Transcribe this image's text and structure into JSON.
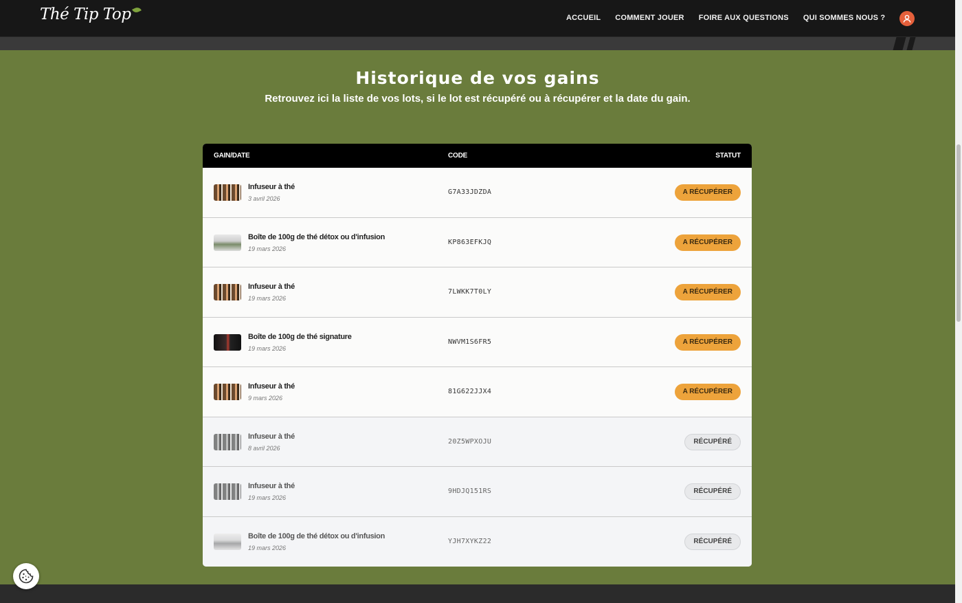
{
  "header": {
    "logo_text": "Thé Tip Top",
    "nav": [
      "ACCUEIL",
      "COMMENT JOUER",
      "FOIRE AUX QUESTIONS",
      "QUI SOMMES NOUS ?"
    ],
    "user_icon": "user-icon",
    "accent_color": "#e5603b"
  },
  "page": {
    "title": "Historique de vos gains",
    "subtitle": "Retrouvez ici la liste de vos lots, si le lot est récupéré ou à récupérer et la date du gain.",
    "background_color": "#6a7c3c"
  },
  "table": {
    "columns": [
      "GAIN/DATE",
      "CODE",
      "STATUT"
    ],
    "rows": [
      {
        "prize": "Infuseur à thé",
        "date": "3 avril 2026",
        "code": "G7A33JDZDA",
        "status": "A RÉCUPÉRER",
        "state": "pending",
        "image": "infuser"
      },
      {
        "prize": "Boîte de 100g de thé détox ou d'infusion",
        "date": "19 mars 2026",
        "code": "KP863EFKJQ",
        "status": "A RÉCUPÉRER",
        "state": "pending",
        "image": "box"
      },
      {
        "prize": "Infuseur à thé",
        "date": "19 mars 2026",
        "code": "7LWKK7T0LY",
        "status": "A RÉCUPÉRER",
        "state": "pending",
        "image": "infuser"
      },
      {
        "prize": "Boîte de 100g de thé signature",
        "date": "19 mars 2026",
        "code": "NWVM1S6FR5",
        "status": "A RÉCUPÉRER",
        "state": "pending",
        "image": "signature"
      },
      {
        "prize": "Infuseur à thé",
        "date": "9 mars 2026",
        "code": "81G622JJX4",
        "status": "A RÉCUPÉRER",
        "state": "pending",
        "image": "infuser"
      },
      {
        "prize": "Infuseur à thé",
        "date": "8 avril 2026",
        "code": "20Z5WPXOJU",
        "status": "RÉCUPÉRÉ",
        "state": "collected",
        "image": "infuser"
      },
      {
        "prize": "Infuseur à thé",
        "date": "19 mars 2026",
        "code": "9HDJQ151RS",
        "status": "RÉCUPÉRÉ",
        "state": "collected",
        "image": "infuser"
      },
      {
        "prize": "Boîte de 100g de thé détox ou d'infusion",
        "date": "19 mars 2026",
        "code": "YJH7XYKZ22",
        "status": "RÉCUPÉRÉ",
        "state": "collected",
        "image": "box"
      }
    ],
    "pending_color": "#eda33b",
    "collected_color": "#e8e9eb"
  },
  "cookie": {
    "icon": "cookie-icon"
  }
}
